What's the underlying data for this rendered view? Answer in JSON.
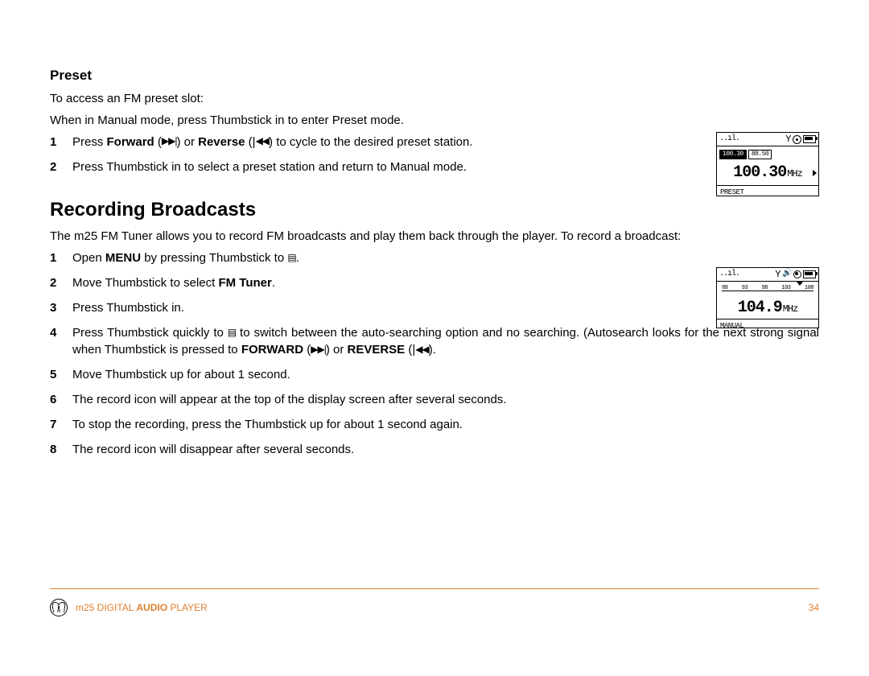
{
  "preset": {
    "heading": "Preset",
    "intro1": "To access an FM preset slot:",
    "intro2": "When in Manual mode, press Thumbstick in to enter Preset mode.",
    "steps": [
      {
        "num": "1",
        "pre": "Press ",
        "b1": "Forward",
        "mid1": " (",
        "icon1": "▶▶|",
        "mid2": ") or ",
        "b2": "Reverse",
        "mid3": " (|",
        "icon2": "◀◀",
        "post": ") to cycle to the desired preset station."
      },
      {
        "num": "2",
        "text": "Press Thumbstick in to select a preset station and return to Manual mode."
      }
    ]
  },
  "recording": {
    "heading": "Recording Broadcasts",
    "intro": "The m25 FM Tuner allows you to record FM broadcasts and play them back through the player. To record a broadcast:",
    "steps": [
      {
        "num": "1",
        "pre": "Open ",
        "b1": "MENU",
        "post": " by pressing Thumbstick to ",
        "icon_end": "▤",
        "period": "."
      },
      {
        "num": "2",
        "pre": "Move Thumbstick to select ",
        "b1": "FM Tuner",
        "post": "."
      },
      {
        "num": "3",
        "text": "Press Thumbstick in."
      },
      {
        "num": "4",
        "pre": "Press Thumbstick quickly to ",
        "icon": "▤",
        "mid1": " to switch between the auto-searching option and no searching. (Autosearch looks for the next strong signal when Thumbstick is pressed to ",
        "b1": "FORWARD",
        "mid2": " (",
        "icon2": "▶▶|",
        "mid3": ") or ",
        "b2": "REVERSE",
        "mid4": " (|",
        "icon3": "◀◀",
        "post": ")."
      },
      {
        "num": "5",
        "text": "Move Thumbstick up for about 1 second."
      },
      {
        "num": "6",
        "text": "The record icon will appear at the top of the display screen after several seconds."
      },
      {
        "num": "7",
        "text": "To stop the recording, press the Thumbstick up for about 1 second again."
      },
      {
        "num": "8",
        "text": "The record icon will disappear after several seconds."
      }
    ]
  },
  "lcd1": {
    "tab_active": "100.30",
    "tab_inactive": "88.50",
    "freq": "100.30",
    "unit": "MHz",
    "mode": "PRESET"
  },
  "lcd2": {
    "scale": [
      "88",
      "93",
      "98",
      "103",
      "108"
    ],
    "freq": "104.9",
    "unit": "MHz",
    "mode": "MANUAL"
  },
  "footer": {
    "pre": "m25 DIGITAL ",
    "bold": "AUDIO",
    "post": " PLAYER",
    "page": "34"
  }
}
